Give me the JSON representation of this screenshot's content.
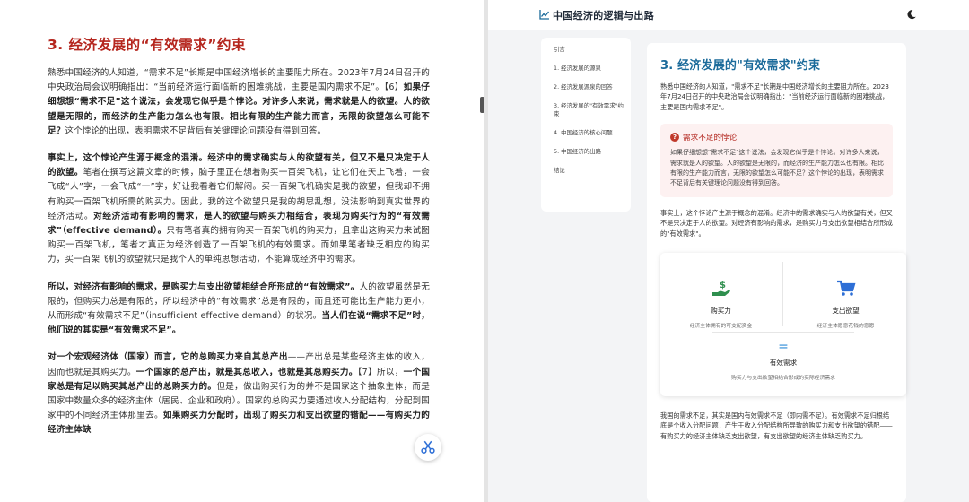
{
  "document": {
    "title": "3. 经济发展的“有效需求”约束",
    "paragraphs": [
      [
        {
          "t": "熟悉中国经济的人知道，“需求不足”长期是中国经济增长的主要阻力所在。2023年7月24日召开的中央政治局会议明确指出：“当前经济运行面临新的困难挑战，主要是国内需求不足”。【6】",
          "b": false
        },
        {
          "t": "如果仔细想想“需求不足”这个说法，会发现它似乎是个悖论。对许多人来说，需求就是人的欲望。人的欲望是无限的，而经济的生产能力怎么也有限。相比有限的生产能力而言，无限的欲望怎么可能不足？",
          "b": true
        },
        {
          "t": "这个悖论的出现，表明需求不足背后有关键理论问题没有得到回答。",
          "b": false
        }
      ],
      [
        {
          "t": "事实上，这个悖论产生源于概念的混淆。经济中的需求确实与人的欲望有关，但又不是只决定于人的欲望。",
          "b": true
        },
        {
          "t": "笔者在撰写这篇文章的时候，脑子里正在想着购买一百架飞机，让它们在天上飞着，一会飞成“人”字，一会飞成“一”字，好让我看着它们解闷。买一百架飞机确实是我的欲望，但我却不拥有购买一百架飞机所需的购买力。因此，我的这个欲望只是我的胡思乱想，没法影响到真实世界的经济活动。",
          "b": false
        },
        {
          "t": "对经济活动有影响的需求，是人的欲望与购买力相结合，表现为购买行为的“有效需求”（effective demand）。",
          "b": true
        },
        {
          "t": "只有笔者真的拥有购买一百架飞机的购买力，且拿出这购买力来试图购买一百架飞机，笔者才真正为经济创造了一百架飞机的有效需求。而如果笔者缺乏相应的购买力，买一百架飞机的欲望就只是我个人的单纯思想活动，不能算成经济中的需求。",
          "b": false
        }
      ],
      [
        {
          "t": "所以，对经济有影响的需求，是购买力与支出欲望相结合所形成的“有效需求”。",
          "b": true
        },
        {
          "t": "人的欲望虽然是无限的，但购买力总是有限的，所以经济中的“有效需求”总是有限的，而且还可能比生产能力更小，从而形成“有效需求不足”（insufficient effective demand）的状况。",
          "b": false
        },
        {
          "t": "当人们在说“需求不足”时，他们说的其实是“有效需求不足”。",
          "b": true
        }
      ],
      [
        {
          "t": "对一个宏观经济体（国家）而言，它的总购买力来自其总产出",
          "b": true
        },
        {
          "t": "——产出总是某些经济主体的收入，因而也就是其购买力。",
          "b": false
        },
        {
          "t": "一个国家的总产出，就是其总收入，也就是其总购买力。",
          "b": true
        },
        {
          "t": "【7】所以，",
          "b": false
        },
        {
          "t": "一个国家总是有足以购买其总产出的总购买力的。",
          "b": true
        },
        {
          "t": "但是，做出购买行为的并不是国家这个抽象主体，而是国家中数量众多的经济主体（居民、企业和政府）。国家的总购买力要通过收入分配结构，分配到国家中的不同经济主体那里去。",
          "b": false
        },
        {
          "t": "如果购买力分配时，出现了购买力和支出欲望的错配——有购买力的经济主体缺",
          "b": true
        }
      ]
    ]
  },
  "app": {
    "title": "中国经济的逻辑与出路",
    "toc": [
      "引言",
      "1. 经济发展的源泉",
      "2. 经济发展源泉的回答",
      "3. 经济发展的\"有效需求\"约束",
      "4. 中国经济的核心问题",
      "5. 中国经济的出路",
      "结论"
    ],
    "section_title": "3. 经济发展的\"有效需求\"约束",
    "intro": "熟悉中国经济的人知道，\"需求不足\"长期是中国经济增长的主要阻力所在。2023年7月24日召开的中央政治局会议明确指出：\"当前经济运行面临新的困难挑战，主要是国内需求不足\"。",
    "paradox": {
      "heading": "需求不足的悖论",
      "text": "如果仔细想想\"需求不足\"这个说法，会发现它似乎是个悖论。对许多人来说，需求就是人的欲望。人的欲望是无限的，而经济的生产能力怎么也有限。相比有限的生产能力而言，无限的欲望怎么可能不足？这个悖论的出现，表明需求不足背后有关键理论问题没有得到回答。"
    },
    "detail": "事实上，这个悖论产生源于概念的混淆。经济中的需求确实与人的欲望有关，但又不是只决定于人的欲望。对经济有影响的需求，是购买力与支出欲望相结合所形成的\"有效需求\"。",
    "concepts": {
      "purchasing_power": {
        "name": "购买力",
        "desc": "经济主体拥有的可支配资金"
      },
      "spending_desire": {
        "name": "支出欲望",
        "desc": "经济主体愿意花钱的意愿"
      },
      "equals": "=",
      "effective_demand": {
        "name": "有效需求",
        "desc": "购买力与支出欲望相结合形成的实际经济需求"
      }
    },
    "closing": "我国的需求不足，其实是国内有效需求不足（即内需不足）。有效需求不足归根结底是个收入分配问题，产生于收入分配结构所导致的购买力和支出欲望的错配——有购买力的经济主体缺乏支出欲望，有支出欲望的经济主体缺乏购买力。"
  },
  "colors": {
    "doc_title": "#b5261e",
    "section_title": "#1a6a9a",
    "alert": "#b3261e",
    "icon_green": "#2f8f4e",
    "icon_blue": "#2e8bd8"
  },
  "icons": {
    "app_logo": "line-chart-icon",
    "theme_toggle": "moon-icon",
    "scissors": "scissors-icon",
    "alert": "exclamation-circle-icon",
    "purchasing_power": "hand-dollar-icon",
    "spending_desire": "shopping-cart-icon"
  }
}
